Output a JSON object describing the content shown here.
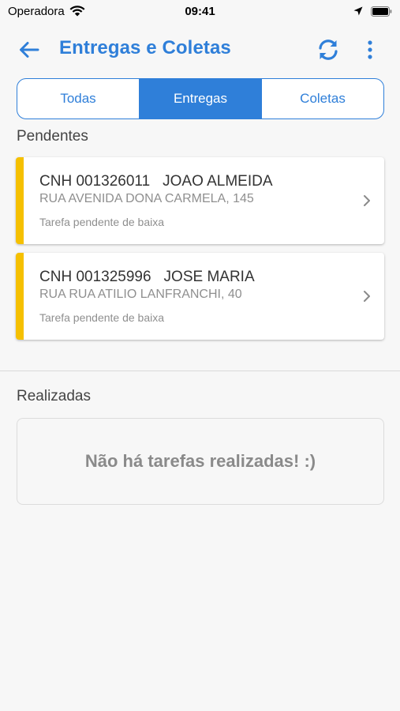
{
  "status_bar": {
    "carrier": "Operadora",
    "time": "09:41"
  },
  "app_bar": {
    "title": "Entregas e Coletas",
    "icons": [
      "arrow-left-icon",
      "sync-icon",
      "more-vertical-icon"
    ]
  },
  "tabs": [
    {
      "label": "Todas",
      "active": false
    },
    {
      "label": "Entregas",
      "active": true
    },
    {
      "label": "Coletas",
      "active": false
    }
  ],
  "pending": {
    "title": "Pendentes",
    "accent_color": "#f5c000",
    "items": [
      {
        "code": "CNH 001326011",
        "name": "JOAO ALMEIDA",
        "address": "RUA AVENIDA DONA CARMELA, 145",
        "status": "Tarefa pendente de baixa"
      },
      {
        "code": "CNH 001325996",
        "name": "JOSE MARIA",
        "address": "RUA RUA ATILIO LANFRANCHI, 40",
        "status": "Tarefa pendente de baixa"
      }
    ]
  },
  "done": {
    "title": "Realizadas",
    "empty_message": "Não há tarefas realizadas! :)"
  },
  "colors": {
    "primary": "#2f7fd9",
    "background": "#f7f7f7"
  }
}
